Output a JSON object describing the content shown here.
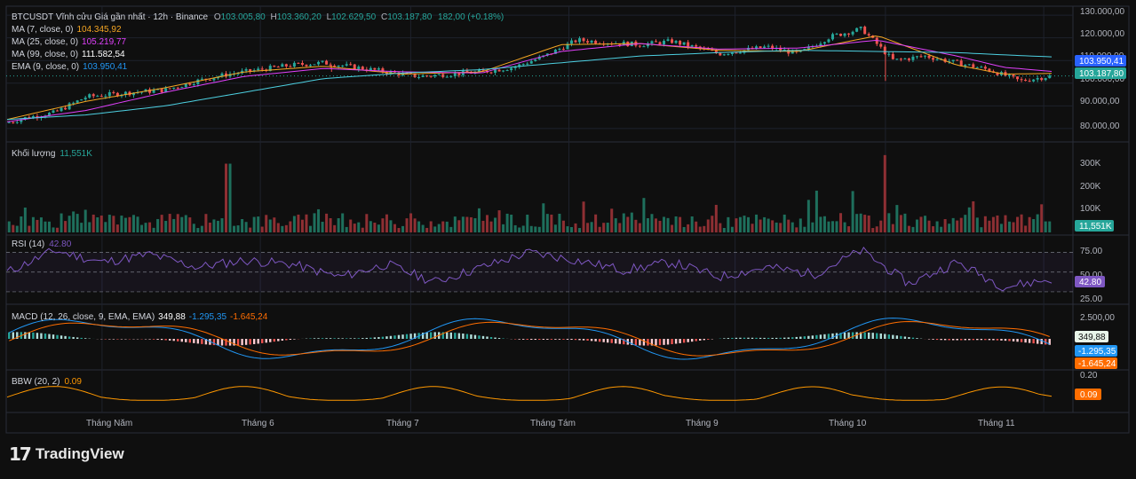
{
  "header": {
    "symbol": "BTCUSDT Vĩnh cửu Giá gần nhất · 12h · Binance",
    "o_label": "O",
    "o": "103.005,80",
    "h_label": "H",
    "h": "103.360,20",
    "l_label": "L",
    "l": "102.629,50",
    "c_label": "C",
    "c": "103.187,80",
    "change": "182,00 (+0.18%)"
  },
  "indicators": {
    "ma7": {
      "label": "MA (7, close, 0)",
      "value": "104.345,92",
      "color": "#f5a623"
    },
    "ma25": {
      "label": "MA (25, close, 0)",
      "value": "105.219,77",
      "color": "#e040fb"
    },
    "ma99": {
      "label": "MA (99, close, 0)",
      "value": "111.582,54",
      "color": "#4dd0e1"
    },
    "ema9": {
      "label": "EMA (9, close, 0)",
      "value": "103.950,41",
      "color": "#2962ff"
    }
  },
  "volume": {
    "label": "Khối lượng",
    "value": "11,551K",
    "ticks": [
      "300K",
      "200K",
      "100K"
    ]
  },
  "rsi": {
    "label": "RSI (14)",
    "value": "42.80",
    "ticks": [
      "75.00",
      "50.00",
      "25.00"
    ]
  },
  "macd": {
    "label": "MACD (12, 26, close, 9, EMA, EMA)",
    "hist": "349,88",
    "macd": "-1.295,35",
    "signal": "-1.645,24",
    "ticks": [
      "2.500,00"
    ]
  },
  "bbw": {
    "label": "BBW (20, 2)",
    "value": "0.09",
    "ticks": [
      "0.20"
    ]
  },
  "price_axis": [
    "130.000,00",
    "120.000,00",
    "110.000,00",
    "100.000,00",
    "90.000,00",
    "80.000,00"
  ],
  "price_tags": {
    "ema": "103.950,41",
    "last": "103.187,80"
  },
  "time_axis": [
    "Tháng Năm",
    "Tháng 6",
    "Tháng 7",
    "Tháng Tám",
    "Tháng 9",
    "Tháng 10",
    "Tháng 11"
  ],
  "brand": {
    "mark": "17",
    "name": "TradingView"
  },
  "colors": {
    "up": "#26a69a",
    "down": "#ef5350",
    "rsi": "#7e57c2",
    "macd": "#2196f3",
    "signal": "#ff6d00",
    "bbw": "#ff9800"
  },
  "chart_data": {
    "type": "line",
    "xlabel": "",
    "ylabel": "",
    "x": [
      "Tháng Năm",
      "Tháng 6",
      "Tháng 7",
      "Tháng Tám",
      "Tháng 9",
      "Tháng 10",
      "Tháng 11"
    ],
    "series": [
      {
        "name": "BTCUSDT",
        "x": [
          0,
          0.1,
          0.3,
          0.5,
          0.8,
          1.0,
          1.2,
          1.4,
          1.6,
          1.8,
          2.0,
          2.3,
          2.6,
          3.0,
          3.2,
          3.4,
          3.6,
          3.8,
          4.0,
          4.2,
          4.5,
          4.8,
          5.0,
          5.2,
          5.4,
          5.6,
          5.8,
          6.0,
          6.2,
          6.4,
          6.6
        ],
        "values": [
          82500,
          84500,
          87000,
          94000,
          96000,
          97000,
          101000,
          104000,
          106000,
          108000,
          109000,
          106000,
          103000,
          105000,
          107000,
          112000,
          119000,
          118000,
          117000,
          118500,
          113000,
          116000,
          113000,
          120500,
          124000,
          110000,
          112000,
          109000,
          106000,
          101000,
          103200
        ]
      },
      {
        "name": "MA (7, close, 0)",
        "x": [
          0,
          0.5,
          1.0,
          1.5,
          2.0,
          2.5,
          3.0,
          3.5,
          4.0,
          4.5,
          5.0,
          5.5,
          6.0,
          6.3,
          6.6
        ],
        "values": [
          84000,
          92000,
          98000,
          105000,
          107500,
          104000,
          105000,
          117000,
          117500,
          114500,
          114000,
          121000,
          108000,
          104000,
          104300
        ]
      },
      {
        "name": "MA (25, close, 0)",
        "x": [
          0,
          0.5,
          1.0,
          1.5,
          2.0,
          2.5,
          3.0,
          3.5,
          4.0,
          4.5,
          5.0,
          5.5,
          6.0,
          6.3,
          6.6
        ],
        "values": [
          83000,
          88000,
          96000,
          103000,
          106500,
          105000,
          104500,
          114000,
          117500,
          115000,
          115500,
          119000,
          112000,
          107000,
          105200
        ]
      },
      {
        "name": "MA (99, close, 0)",
        "x": [
          0,
          0.5,
          1.0,
          1.5,
          2.0,
          2.5,
          3.0,
          3.5,
          4.0,
          4.5,
          5.0,
          5.5,
          6.0,
          6.3,
          6.6
        ],
        "values": [
          84000,
          86000,
          90000,
          96000,
          102000,
          104500,
          106000,
          109000,
          112000,
          113500,
          114500,
          114000,
          113500,
          112500,
          111600
        ]
      }
    ],
    "y_ticks": [
      80000,
      90000,
      100000,
      110000,
      120000,
      130000
    ],
    "ylim": [
      78000,
      132000
    ],
    "rsi": {
      "x": [
        0,
        0.3,
        0.6,
        0.9,
        1.2,
        1.5,
        1.8,
        2.1,
        2.4,
        2.7,
        3.0,
        3.3,
        3.6,
        3.9,
        4.2,
        4.5,
        4.8,
        5.1,
        5.4,
        5.7,
        6.0,
        6.3,
        6.6
      ],
      "values": [
        50,
        72,
        60,
        68,
        55,
        62,
        58,
        45,
        58,
        40,
        55,
        70,
        62,
        52,
        60,
        45,
        55,
        48,
        72,
        38,
        60,
        35,
        42.8
      ],
      "ylim": [
        20,
        85
      ]
    },
    "macd_ylim": [
      -3500,
      3500
    ],
    "bbw_ylim": [
      0,
      0.22
    ]
  }
}
